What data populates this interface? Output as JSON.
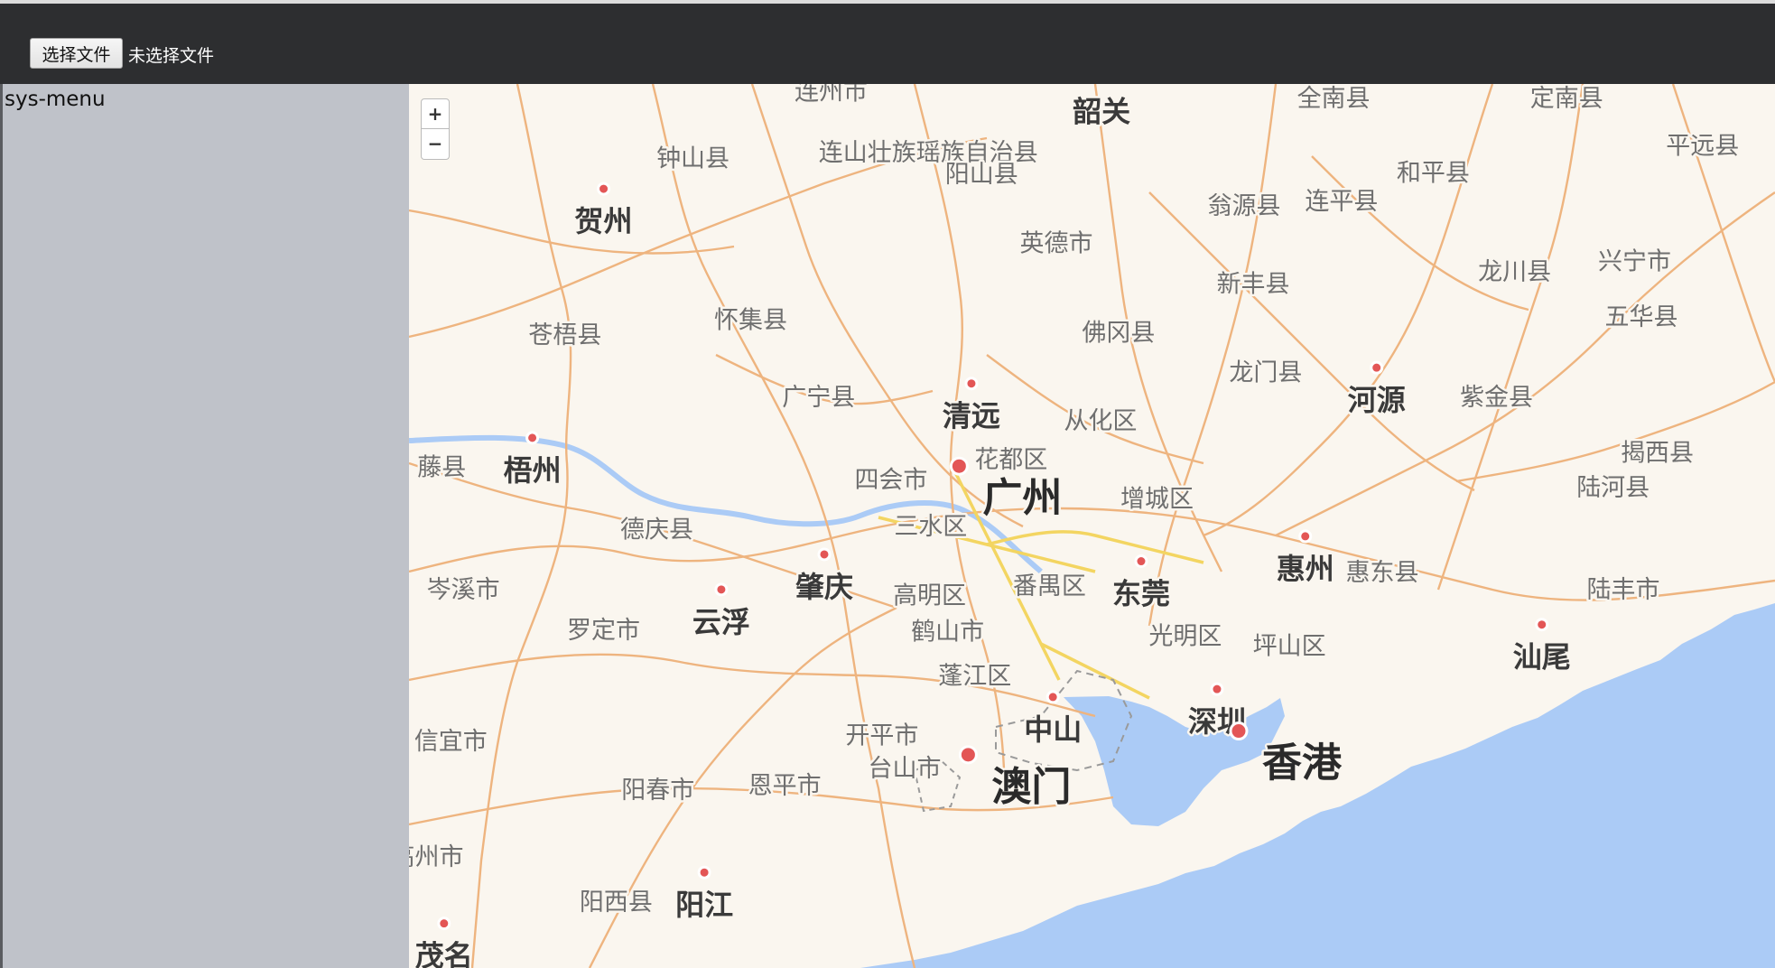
{
  "toolbar": {
    "file_button_label": "选择文件",
    "file_status": "未选择文件"
  },
  "sidebar": {
    "title": "sys-menu"
  },
  "map": {
    "zoom_in": "+",
    "zoom_out": "−",
    "colors": {
      "land": "#faf6ef",
      "water": "#abcbf6",
      "road": "#eeb47f",
      "highway": "#f3d561",
      "city_marker": "#e35656",
      "sidebar": "#bfc2c9",
      "topbar": "#2d2e30"
    },
    "labels": [
      {
        "name": "label-shaoguan",
        "text": "韶关",
        "kind": "city",
        "marker": false
      },
      {
        "name": "label-quannan",
        "text": "全南县",
        "kind": "county",
        "marker": false
      },
      {
        "name": "label-dingnan",
        "text": "定南县",
        "kind": "county",
        "marker": false
      },
      {
        "name": "label-lianzhou",
        "text": "连州市",
        "kind": "county",
        "marker": false
      },
      {
        "name": "label-lianshan",
        "text": "连山壮族瑶族自治县",
        "kind": "county",
        "marker": false
      },
      {
        "name": "label-zhongshanxian",
        "text": "钟山县",
        "kind": "county",
        "marker": false
      },
      {
        "name": "label-yangshan",
        "text": "阳山县",
        "kind": "county",
        "marker": false
      },
      {
        "name": "label-pingyuan",
        "text": "平远县",
        "kind": "county",
        "marker": false
      },
      {
        "name": "label-heping",
        "text": "和平县",
        "kind": "county",
        "marker": false
      },
      {
        "name": "label-wengyuan",
        "text": "翁源县",
        "kind": "county",
        "marker": false
      },
      {
        "name": "label-lianping",
        "text": "连平县",
        "kind": "county",
        "marker": false
      },
      {
        "name": "label-hezhou",
        "text": "贺州",
        "kind": "city",
        "marker": true
      },
      {
        "name": "label-yingde",
        "text": "英德市",
        "kind": "county",
        "marker": false
      },
      {
        "name": "label-longchuan",
        "text": "龙川县",
        "kind": "county",
        "marker": false
      },
      {
        "name": "label-xingning",
        "text": "兴宁市",
        "kind": "county",
        "marker": false
      },
      {
        "name": "label-xinfeng",
        "text": "新丰县",
        "kind": "county",
        "marker": false
      },
      {
        "name": "label-wuhua",
        "text": "五华县",
        "kind": "county",
        "marker": false
      },
      {
        "name": "label-cangwu",
        "text": "苍梧县",
        "kind": "county",
        "marker": false
      },
      {
        "name": "label-huaiji",
        "text": "怀集县",
        "kind": "county",
        "marker": false
      },
      {
        "name": "label-fogang",
        "text": "佛冈县",
        "kind": "county",
        "marker": false
      },
      {
        "name": "label-longmen",
        "text": "龙门县",
        "kind": "county",
        "marker": false
      },
      {
        "name": "label-heyuan",
        "text": "河源",
        "kind": "city",
        "marker": true
      },
      {
        "name": "label-zijin",
        "text": "紫金县",
        "kind": "county",
        "marker": false
      },
      {
        "name": "label-guangning",
        "text": "广宁县",
        "kind": "county",
        "marker": false
      },
      {
        "name": "label-qingyuan",
        "text": "清远",
        "kind": "city",
        "marker": true
      },
      {
        "name": "label-conghua",
        "text": "从化区",
        "kind": "county",
        "marker": false
      },
      {
        "name": "label-jiexi",
        "text": "揭西县",
        "kind": "county",
        "marker": false
      },
      {
        "name": "label-tengxian",
        "text": "藤县",
        "kind": "county",
        "marker": false
      },
      {
        "name": "label-wuzhou",
        "text": "梧州",
        "kind": "city",
        "marker": true
      },
      {
        "name": "label-huadu",
        "text": "花都区",
        "kind": "county",
        "marker": false
      },
      {
        "name": "label-sihui",
        "text": "四会市",
        "kind": "county",
        "marker": false
      },
      {
        "name": "label-luhe",
        "text": "陆河县",
        "kind": "county",
        "marker": false
      },
      {
        "name": "label-guangzhou",
        "text": "广州",
        "kind": "major",
        "marker": true
      },
      {
        "name": "label-zengcheng",
        "text": "增城区",
        "kind": "county",
        "marker": false
      },
      {
        "name": "label-deqing",
        "text": "德庆县",
        "kind": "county",
        "marker": false
      },
      {
        "name": "label-sanshui",
        "text": "三水区",
        "kind": "county",
        "marker": false
      },
      {
        "name": "label-huizhou",
        "text": "惠州",
        "kind": "city",
        "marker": true
      },
      {
        "name": "label-huidong",
        "text": "惠东县",
        "kind": "county",
        "marker": false
      },
      {
        "name": "label-lufeng",
        "text": "陆丰市",
        "kind": "county",
        "marker": false
      },
      {
        "name": "label-cenxi",
        "text": "岑溪市",
        "kind": "county",
        "marker": false
      },
      {
        "name": "label-zhaoqing",
        "text": "肇庆",
        "kind": "city",
        "marker": true
      },
      {
        "name": "label-dongguan",
        "text": "东莞",
        "kind": "city",
        "marker": true
      },
      {
        "name": "label-panyu",
        "text": "番禺区",
        "kind": "county",
        "marker": false
      },
      {
        "name": "label-gaoming",
        "text": "高明区",
        "kind": "county",
        "marker": false
      },
      {
        "name": "label-yunfu",
        "text": "云浮",
        "kind": "city",
        "marker": true
      },
      {
        "name": "label-luoding",
        "text": "罗定市",
        "kind": "county",
        "marker": false
      },
      {
        "name": "label-heshan",
        "text": "鹤山市",
        "kind": "county",
        "marker": false
      },
      {
        "name": "label-guangming",
        "text": "光明区",
        "kind": "county",
        "marker": false
      },
      {
        "name": "label-pingshan",
        "text": "坪山区",
        "kind": "county",
        "marker": false
      },
      {
        "name": "label-shanwei",
        "text": "汕尾",
        "kind": "city",
        "marker": true
      },
      {
        "name": "label-pengjiang",
        "text": "蓬江区",
        "kind": "county",
        "marker": false
      },
      {
        "name": "label-zhongshan",
        "text": "中山",
        "kind": "city",
        "marker": true
      },
      {
        "name": "label-shenzhen",
        "text": "深圳",
        "kind": "city",
        "marker": true
      },
      {
        "name": "label-xinyi",
        "text": "信宜市",
        "kind": "county",
        "marker": false
      },
      {
        "name": "label-kaiping",
        "text": "开平市",
        "kind": "county",
        "marker": false
      },
      {
        "name": "label-hongkong",
        "text": "香港",
        "kind": "major",
        "marker": true
      },
      {
        "name": "label-taishan",
        "text": "台山市",
        "kind": "county",
        "marker": false
      },
      {
        "name": "label-macau",
        "text": "澳门",
        "kind": "major",
        "marker": true
      },
      {
        "name": "label-yangchun",
        "text": "阳春市",
        "kind": "county",
        "marker": false
      },
      {
        "name": "label-enping",
        "text": "恩平市",
        "kind": "county",
        "marker": false
      },
      {
        "name": "label-gaozhou",
        "text": "高州市",
        "kind": "county",
        "marker": false
      },
      {
        "name": "label-yangxi",
        "text": "阳西县",
        "kind": "county",
        "marker": false
      },
      {
        "name": "label-yangjiang",
        "text": "阳江",
        "kind": "city",
        "marker": true
      },
      {
        "name": "label-maoming",
        "text": "茂名",
        "kind": "city",
        "marker": true
      }
    ]
  }
}
